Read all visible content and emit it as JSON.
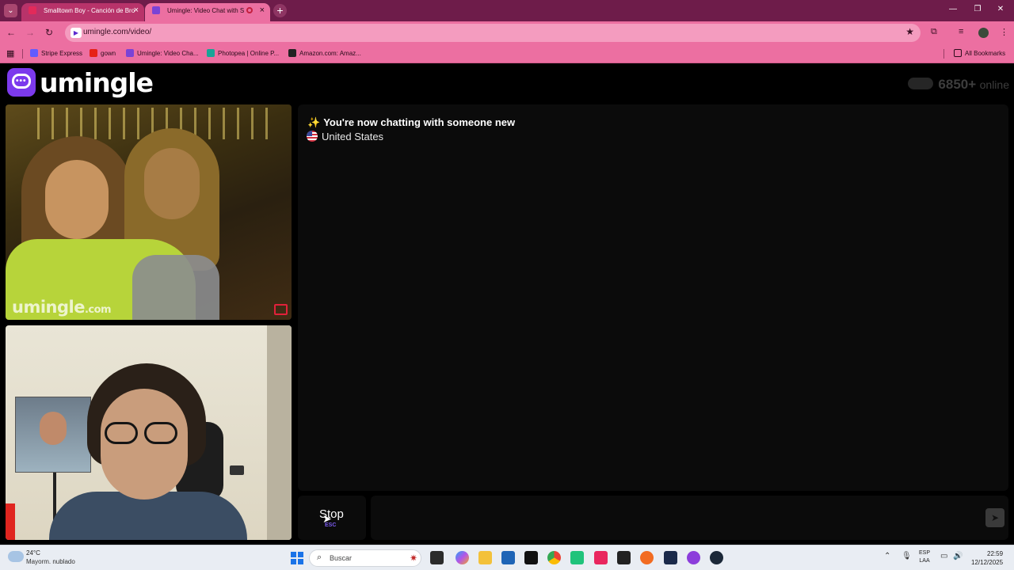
{
  "browser": {
    "tabs": [
      {
        "title": "Smalltown Boy - Canción de Bro"
      },
      {
        "title": "Umingle: Video Chat with S"
      }
    ],
    "url": "umingle.com/video/",
    "bookmarks": [
      {
        "label": "Stripe Express",
        "color": "#635bff"
      },
      {
        "label": "gown",
        "color": "#e62117"
      },
      {
        "label": "Umingle: Video Cha...",
        "color": "#7b43d6"
      },
      {
        "label": "Photopea | Online P...",
        "color": "#18a497"
      },
      {
        "label": "Amazon.com: Amaz...",
        "color": "#222222"
      }
    ],
    "all_bookmarks": "All Bookmarks"
  },
  "site": {
    "logo_text": "umingle",
    "online_count": "6850+",
    "online_label": "online",
    "watermark": "umingle",
    "watermark_suffix": ".com"
  },
  "chat": {
    "status": "You're now chatting with someone new",
    "country": "United States",
    "message_placeholder": ""
  },
  "controls": {
    "stop_label": "Stop",
    "esc_hint": "ESC"
  },
  "taskbar": {
    "weather_temp": "24°C",
    "weather_desc": "Mayorm. nublado",
    "search_placeholder": "Buscar",
    "lang_1": "ESP",
    "lang_2": "LAA",
    "time": "22:59",
    "date": "12/12/2025"
  }
}
